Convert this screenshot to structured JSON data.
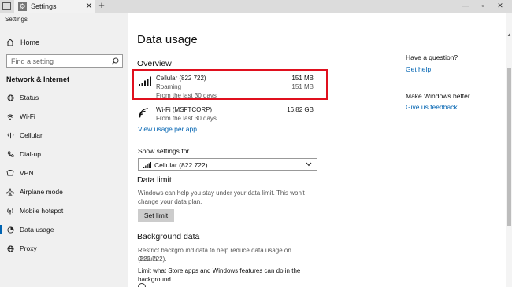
{
  "window": {
    "tab_title": "Settings",
    "close_glyph": "✕",
    "new_tab_glyph": "+",
    "minimize_glyph": "—",
    "maximize_glyph": "▫",
    "win_close_glyph": "✕"
  },
  "sidebar": {
    "app_title": "Settings",
    "home_label": "Home",
    "search_placeholder": "Find a setting",
    "section_heading": "Network & Internet",
    "items": [
      {
        "label": "Status",
        "icon": "globe-icon"
      },
      {
        "label": "Wi-Fi",
        "icon": "wifi-icon"
      },
      {
        "label": "Cellular",
        "icon": "cellular-icon"
      },
      {
        "label": "Dial-up",
        "icon": "phone-icon"
      },
      {
        "label": "VPN",
        "icon": "vpn-icon"
      },
      {
        "label": "Airplane mode",
        "icon": "airplane-icon"
      },
      {
        "label": "Mobile hotspot",
        "icon": "hotspot-icon"
      },
      {
        "label": "Data usage",
        "icon": "data-usage-icon",
        "active": true
      },
      {
        "label": "Proxy",
        "icon": "globe-icon"
      }
    ]
  },
  "main": {
    "title": "Data usage",
    "overview_heading": "Overview",
    "rows": [
      {
        "name": "Cellular (822 722)",
        "amount": "151 MB",
        "sub1": "Roaming",
        "sub1_amount": "151 MB",
        "sub2": "From the last 30 days",
        "icon": "cellular-signal-icon"
      },
      {
        "name": "Wi-Fi (MSFTCORP)",
        "amount": "16.82 GB",
        "sub1": "From the last 30 days",
        "icon": "wifi-icon"
      }
    ],
    "view_usage_link": "View usage per app",
    "show_settings_label": "Show settings for",
    "dropdown_value": "Cellular (822 722)",
    "data_limit_heading": "Data limit",
    "data_limit_text_1": "Windows can help you stay under your data limit. This won't",
    "data_limit_text_2": "change your data plan.",
    "set_limit_button": "Set limit",
    "background_heading": "Background data",
    "background_text_1": "Restrict background data to help reduce data usage on Cellular",
    "background_text_2": "(822 722).",
    "limit_text_1": "Limit what Store apps and Windows features can do in the",
    "limit_text_2": "background"
  },
  "right": {
    "question_heading": "Have a question?",
    "help_link": "Get help",
    "better_heading": "Make Windows better",
    "feedback_link": "Give us feedback"
  },
  "colors": {
    "accent": "#0063b1",
    "highlight": "#e0101e"
  }
}
